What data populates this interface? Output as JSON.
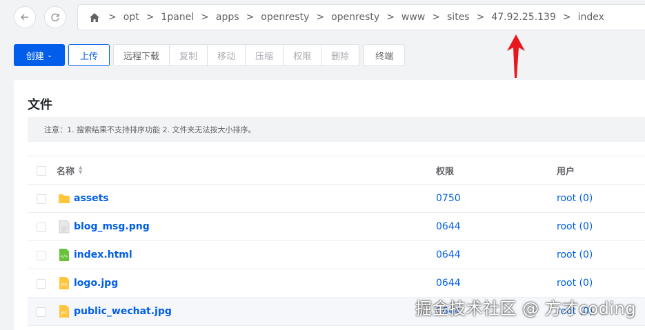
{
  "breadcrumb": [
    "opt",
    "1panel",
    "apps",
    "openresty",
    "openresty",
    "www",
    "sites",
    "47.92.25.139",
    "index"
  ],
  "toolbar": {
    "create": "创建",
    "upload": "上传",
    "remote_download": "远程下载",
    "copy": "复制",
    "move": "移动",
    "compress": "压缩",
    "permission": "权限",
    "delete": "删除",
    "terminal": "终端"
  },
  "card": {
    "title": "文件",
    "notice": "注意：1. 搜索结果不支持排序功能 2. 文件夹无法按大小排序。"
  },
  "table": {
    "headers": {
      "name": "名称",
      "permission": "权限",
      "user": "用户"
    },
    "rows": [
      {
        "name": "assets",
        "icon": "folder-icon",
        "permission": "0750",
        "user": "root (0)"
      },
      {
        "name": "blog_msg.png",
        "icon": "image-file-icon",
        "permission": "0644",
        "user": "root (0)"
      },
      {
        "name": "index.html",
        "icon": "html-file-icon",
        "permission": "0644",
        "user": "root (0)"
      },
      {
        "name": "logo.jpg",
        "icon": "jpg-file-icon",
        "permission": "0644",
        "user": "root (0)"
      },
      {
        "name": "public_wechat.jpg",
        "icon": "jpg-file-icon",
        "permission": "0644",
        "user": "root (0)"
      }
    ]
  },
  "watermark": "掘金技术社区 @ 方才coding",
  "colors": {
    "primary": "#005eeb",
    "arrow": "#e8161d",
    "folder": "#ffc53d",
    "html": "#67c23a"
  }
}
